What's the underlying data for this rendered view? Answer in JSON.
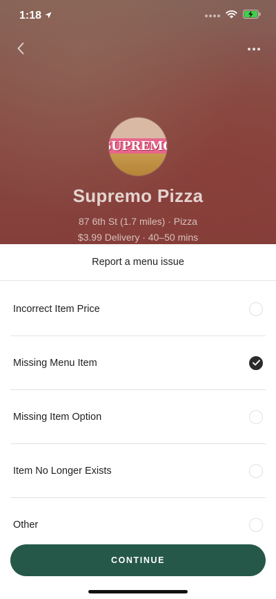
{
  "status_bar": {
    "time": "1:18"
  },
  "restaurant": {
    "logo_text": "SUPREMO",
    "name": "Supremo Pizza",
    "meta_line1": "87 6th St (1.7 miles) · Pizza",
    "meta_line2": "$3.99 Delivery · 40–50 mins"
  },
  "sheet": {
    "title": "Report a menu issue",
    "options": [
      {
        "label": "Incorrect Item Price",
        "selected": false
      },
      {
        "label": "Missing Menu Item",
        "selected": true
      },
      {
        "label": "Missing Item Option",
        "selected": false
      },
      {
        "label": "Item No Longer Exists",
        "selected": false
      },
      {
        "label": "Other",
        "selected": false
      }
    ],
    "continue_label": "CONTINUE"
  },
  "colors": {
    "accent": "#255848",
    "selected_radio": "#2b2b2b"
  },
  "icons": [
    "location-arrow-icon",
    "signal-icon",
    "wifi-icon",
    "battery-charging-icon",
    "back-chevron-icon",
    "more-dots-icon",
    "checkmark-icon"
  ]
}
